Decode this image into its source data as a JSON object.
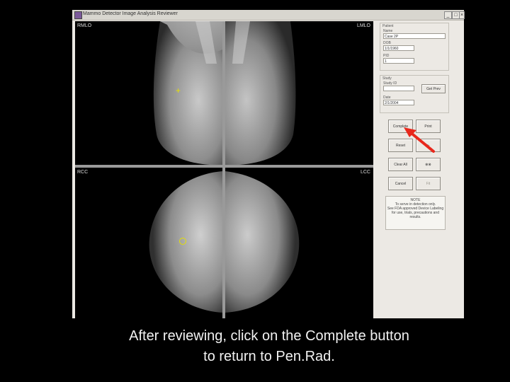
{
  "window": {
    "title": "Mammo Detector Image Analysis Reviewer",
    "buttons": [
      "_",
      "□",
      "×"
    ]
  },
  "viewer": {
    "views": [
      "RMLO",
      "LMLO",
      "RCC",
      "LCC"
    ]
  },
  "patient": {
    "group_label": "Patient",
    "name_label": "Name",
    "name_value": "Case 2P",
    "dob_label": "DOB",
    "dob_value": "1/1/1960",
    "pid_label": "PID",
    "pid_value": "1"
  },
  "study": {
    "group_label": "Study",
    "study_id_label": "Study ID",
    "study_id_value": "",
    "get_button": "Get Prev",
    "date_label": "Date",
    "date_value": "2/1/2004"
  },
  "buttons": {
    "complete": "Complete",
    "print": "Print",
    "reset": "Reset",
    "play": "▷",
    "clear_all": "Clear All",
    "binoculars": "⊗⊗",
    "cancel": "Cancel",
    "save": "Fit"
  },
  "notes": {
    "title": "NOTE",
    "line1": "To serve in detection only.",
    "line2": "See FDA approved Device Labeling",
    "line3": "for use, trials, precautions and",
    "line4": "results."
  },
  "caption": {
    "line1": "After reviewing, click on the Complete button",
    "line2": "to return to Pen.Rad."
  },
  "colors": {
    "annotation_marker": "#e5e000",
    "pointer_arrow": "#e8281c"
  }
}
